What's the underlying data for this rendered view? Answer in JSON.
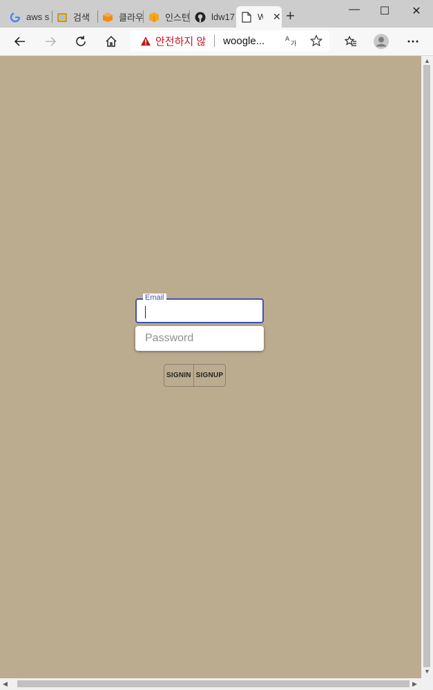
{
  "browser": {
    "tabs": [
      {
        "label": "aws s",
        "icon": "google-icon"
      },
      {
        "label": "검색",
        "icon": "box-icon"
      },
      {
        "label": "클라우",
        "icon": "cube-icon"
      },
      {
        "label": "인스턴",
        "icon": "package-icon"
      },
      {
        "label": "ldw17",
        "icon": "github-icon"
      },
      {
        "label": "W",
        "icon": "page-icon"
      }
    ],
    "new_tab": "+",
    "window_controls": {
      "minimize": "—",
      "maximize": "☐",
      "close": "✕"
    },
    "address": {
      "warning": "안전하지 않",
      "url": "woogle..."
    }
  },
  "login": {
    "email_label": "Email",
    "email_value": "",
    "password_placeholder": "Password",
    "signin_label": "SIGNIN",
    "signup_label": "SIGNUP",
    "accent_color": "#3f51b5",
    "background_color": "#bbac90"
  }
}
